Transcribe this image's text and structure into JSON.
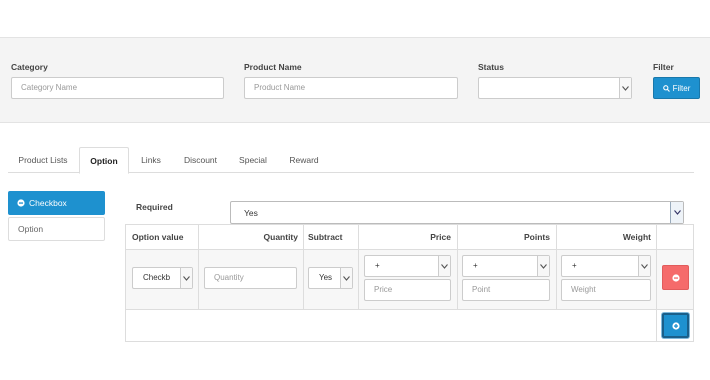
{
  "filter": {
    "category": {
      "label": "Category",
      "placeholder": "Category Name"
    },
    "product_name": {
      "label": "Product Name",
      "placeholder": "Product Name"
    },
    "status": {
      "label": "Status",
      "value": ""
    },
    "filter_heading": "Filter",
    "filter_button": "Filter"
  },
  "tabs": [
    {
      "label": "Product Lists",
      "active": false
    },
    {
      "label": "Option",
      "active": true
    },
    {
      "label": "Links",
      "active": false
    },
    {
      "label": "Discount",
      "active": false
    },
    {
      "label": "Special",
      "active": false
    },
    {
      "label": "Reward",
      "active": false
    }
  ],
  "options_sidebar": {
    "active_item": {
      "label": "Checkbox",
      "icon": "minus-circle-icon"
    },
    "new_option_placeholder": "Option"
  },
  "option_panel": {
    "required_label": "Required",
    "required_value": "Yes",
    "columns": [
      "Option value",
      "Quantity",
      "Subtract",
      "Price",
      "Points",
      "Weight"
    ],
    "row": {
      "option_value": "Checkb",
      "quantity_placeholder": "Quantity",
      "subtract": "Yes",
      "price_prefix": "+",
      "price_placeholder": "Price",
      "points_prefix": "+",
      "points_placeholder": "Point",
      "weight_prefix": "+",
      "weight_placeholder": "Weight"
    }
  },
  "colors": {
    "primary": "#1e91cf",
    "danger": "#f56b6b"
  }
}
